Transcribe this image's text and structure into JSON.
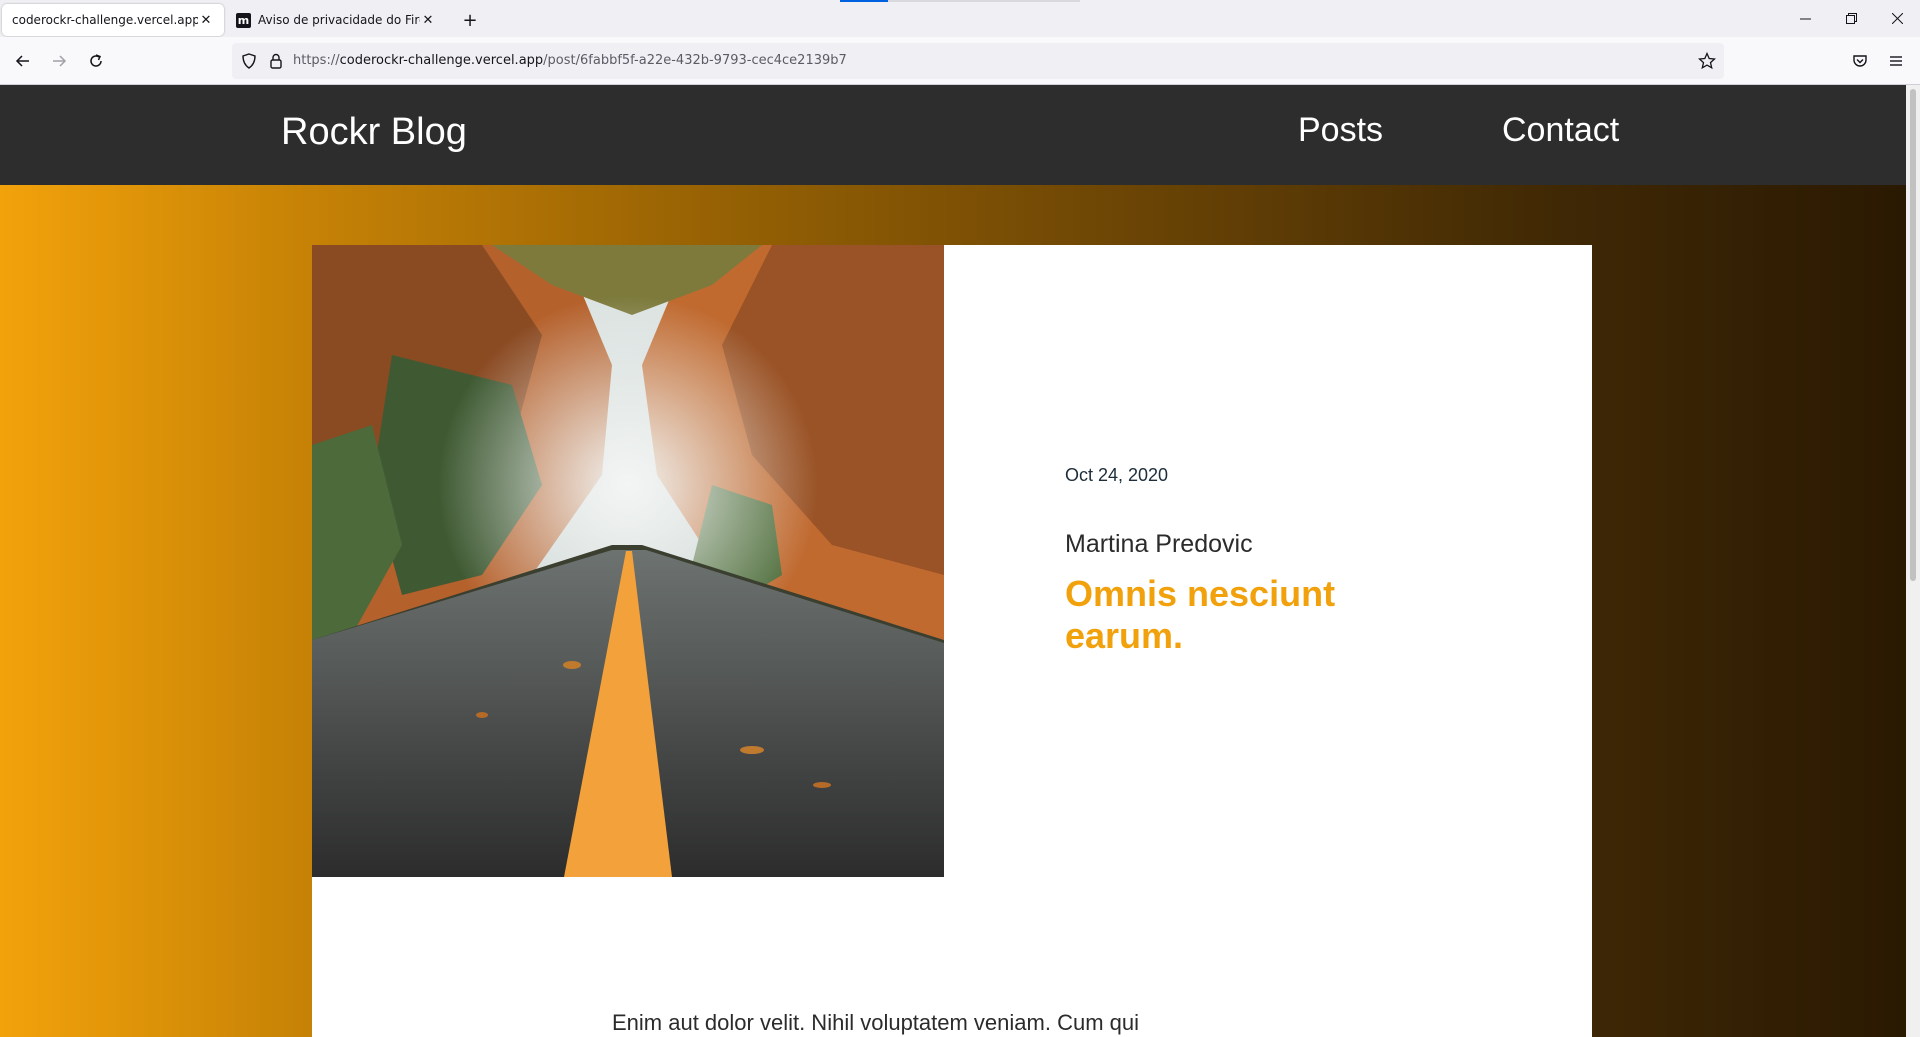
{
  "browser": {
    "tabs": [
      {
        "title": "coderockr-challenge.vercel.app/",
        "active": true
      },
      {
        "title": "Aviso de privacidade do Firefox",
        "active": false,
        "favicon_letter": "m"
      }
    ],
    "url": {
      "scheme": "https://",
      "host": "coderockr-challenge.vercel.app",
      "path": "/post/6fabbf5f-a22e-432b-9793-cec4ce2139b7"
    },
    "icons": {
      "back": "back-arrow-icon",
      "forward": "forward-arrow-icon",
      "reload": "reload-icon",
      "shield": "tracking-protection-shield-icon",
      "lock": "lock-icon",
      "bookmark": "bookmark-star-icon",
      "pocket": "pocket-icon",
      "menu": "hamburger-menu-icon"
    }
  },
  "site": {
    "brand": "Rockr Blog",
    "nav": {
      "posts": "Posts",
      "contact": "Contact"
    }
  },
  "post": {
    "date": "Oct 24, 2020",
    "author": "Martina Predovic",
    "title": "Omnis nesciunt earum.",
    "body_preview": "Enim aut dolor velit. Nihil voluptatem veniam. Cum qui"
  },
  "colors": {
    "header_bg": "#2d2d2d",
    "accent": "#f1a10c",
    "gradient_start": "#f2a20b",
    "gradient_end": "#2a1902"
  }
}
